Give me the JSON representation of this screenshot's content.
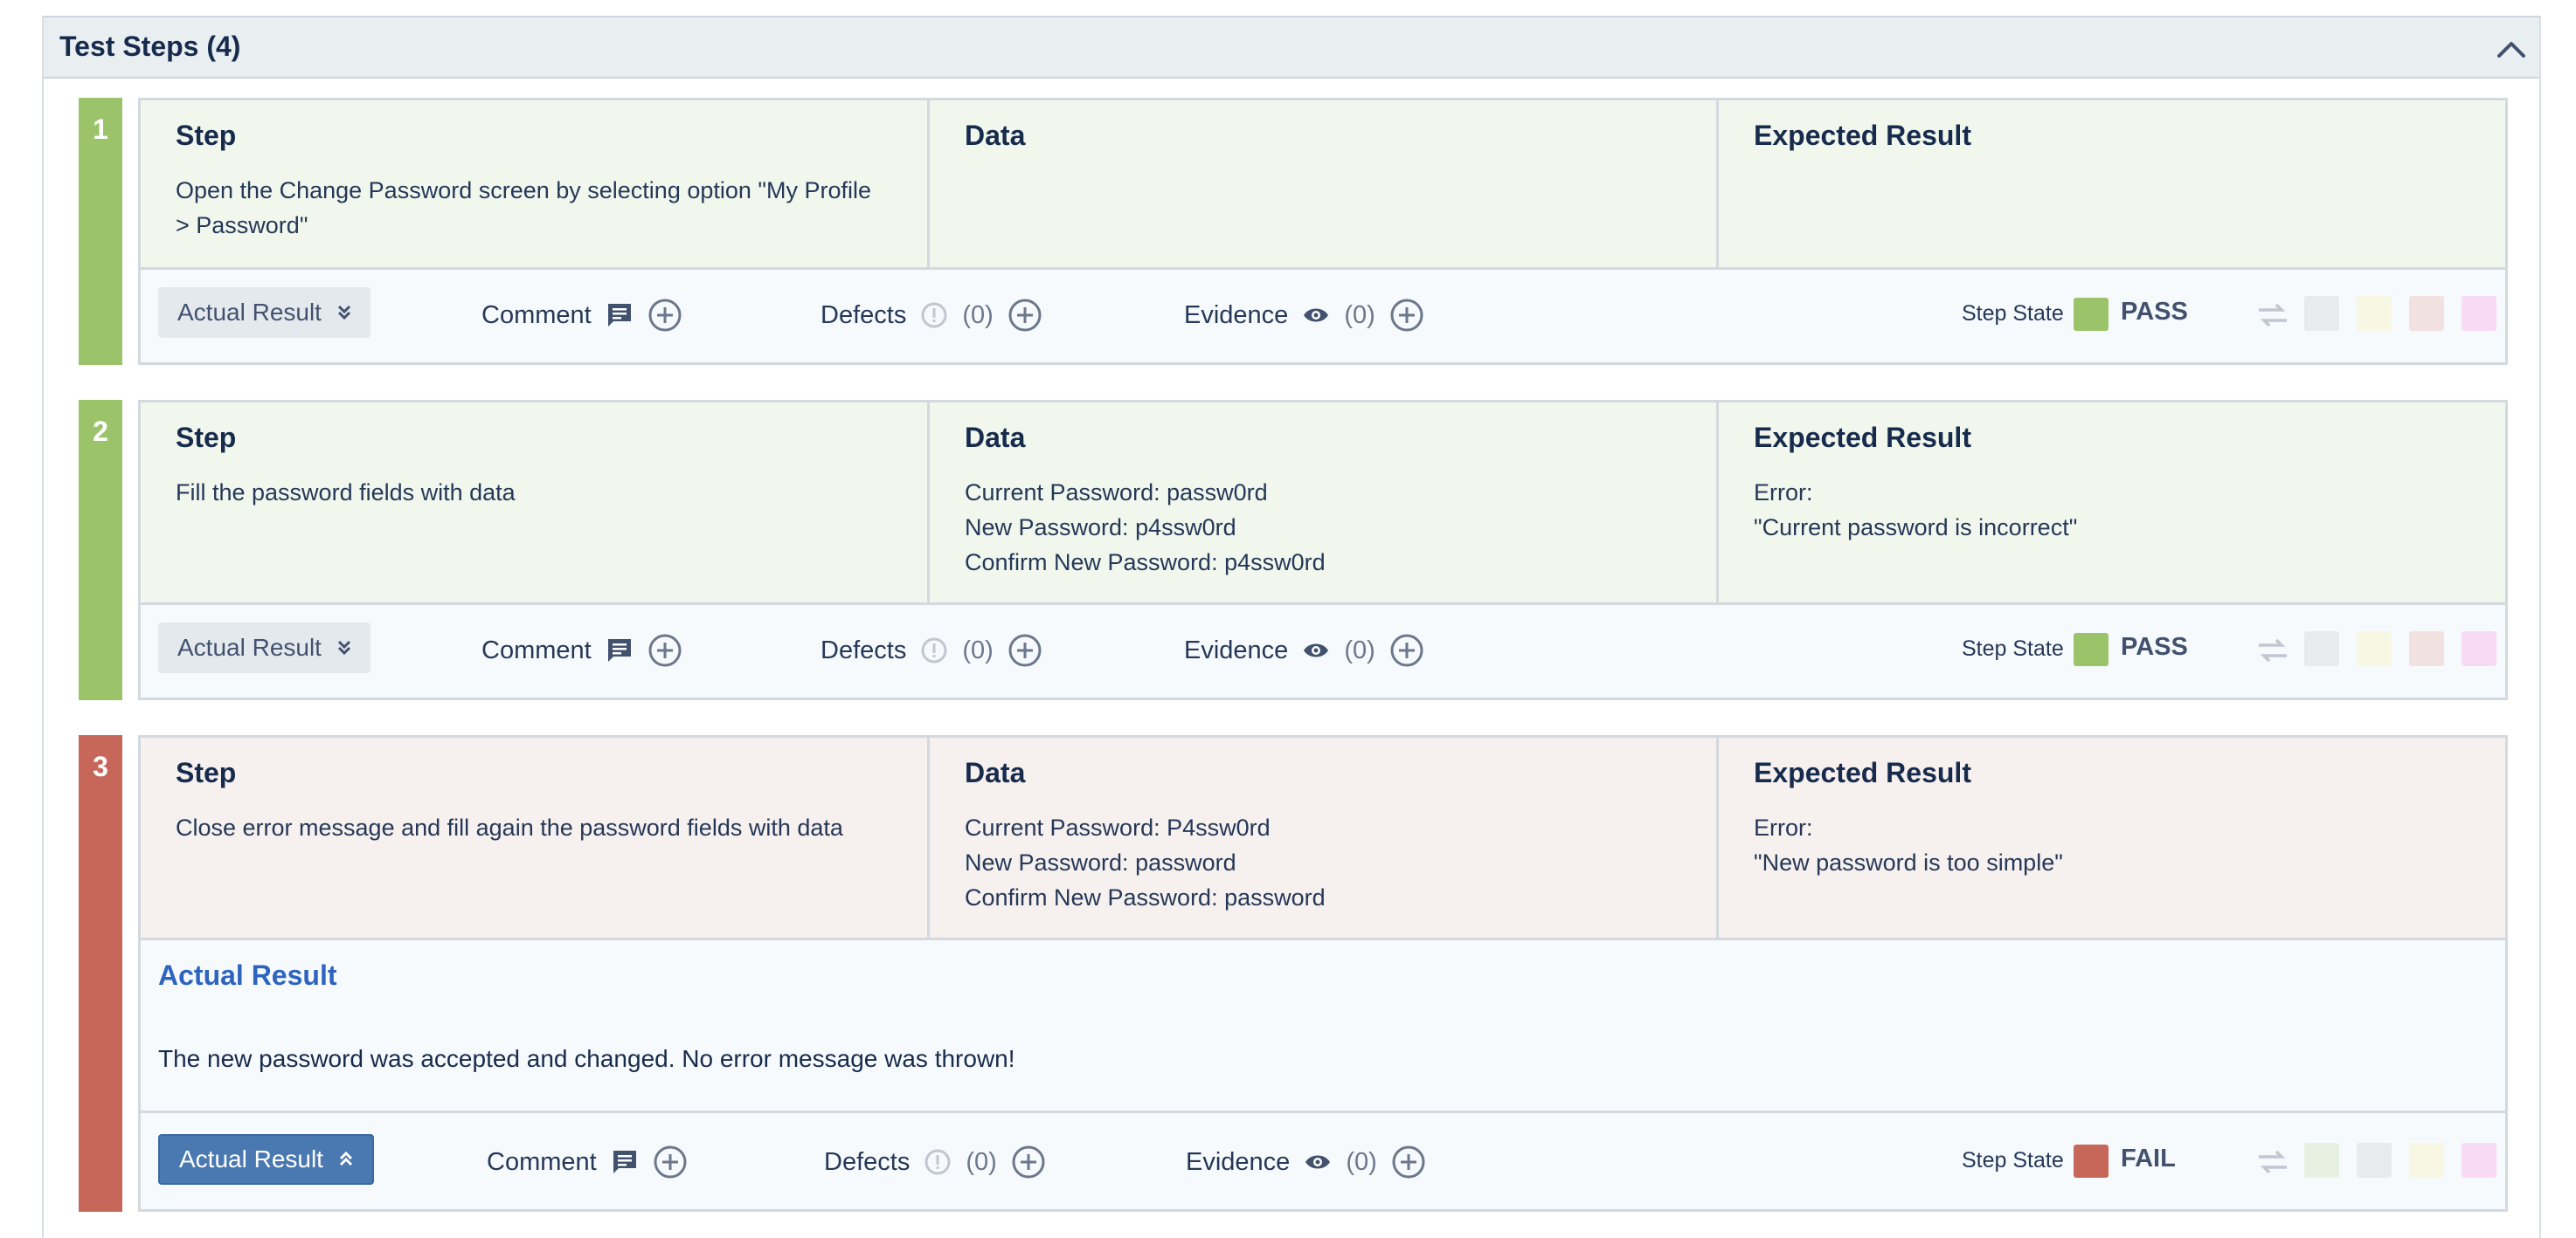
{
  "panel": {
    "title": "Test Steps (4)"
  },
  "labels": {
    "step": "Step",
    "data": "Data",
    "expected": "Expected Result",
    "actual_result": "Actual Result",
    "comment": "Comment",
    "defects": "Defects",
    "evidence": "Evidence",
    "step_state": "Step State",
    "count": "(0)"
  },
  "colors": {
    "pass": "#9bc46a",
    "fail": "#c7675a",
    "pass_bg": "#f1f7ed",
    "fail_bg": "#f6f0ee",
    "accent": "#4a78b0",
    "link": "#2d64c0"
  },
  "steps": [
    {
      "number": "1",
      "state": "PASS",
      "step_text": "Open the Change Password screen by selecting option \"My Profile\n> Password\"",
      "data_text": "",
      "expected_text": "",
      "swatches": [
        "#e8ebee",
        "#f8f7e3",
        "#f1e1e1",
        "#f8daf5"
      ]
    },
    {
      "number": "2",
      "state": "PASS",
      "step_text": "Fill the password fields with data",
      "data_text": "Current Password: passw0rd\nNew Password: p4ssw0rd\nConfirm New Password: p4ssw0rd",
      "expected_text": "Error:\n\"Current password is incorrect\"",
      "swatches": [
        "#e8ebee",
        "#f8f7e3",
        "#f1e1e1",
        "#f8daf5"
      ]
    },
    {
      "number": "3",
      "state": "FAIL",
      "step_text": "Close error message and fill again the password fields with data",
      "data_text": "Current Password: P4ssw0rd\nNew Password: password\nConfirm New Password: password",
      "expected_text": "Error:\n\"New password is too simple\"",
      "actual_result_text": "The new password was accepted and changed. No error message was thrown!",
      "swatches": [
        "#e7f1e1",
        "#e8ebee",
        "#f8f7e3",
        "#f8daf5"
      ]
    }
  ]
}
